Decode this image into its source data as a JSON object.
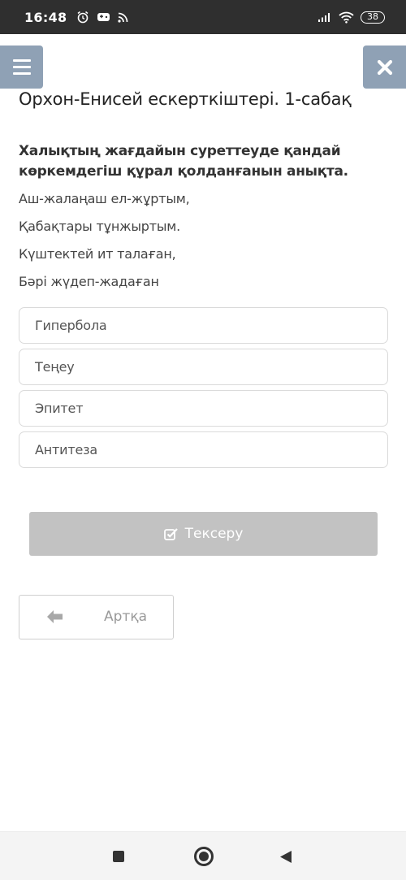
{
  "status_bar": {
    "time": "16:48",
    "battery": "38",
    "icons": [
      "alarm-icon",
      "gamepad-icon",
      "cast-icon",
      "signal-icon",
      "wifi-icon",
      "battery-icon"
    ]
  },
  "header": {
    "menu_icon": "hamburger-icon",
    "close_icon": "close-icon",
    "title": "Орхон-Енисей ескерткіштері. 1-сабақ"
  },
  "question": {
    "prompt": "Халықтың жағдайын суреттеуде қандай көркемдегіш құрал қолданғанын анықта.",
    "lines": [
      "Аш-жалаңаш ел-жұртым,",
      "Қабақтары тұнжыртым.",
      "Күштектей ит талаған,",
      "Бәрі жүдеп-жадаған"
    ]
  },
  "options": [
    {
      "label": "Гипербола"
    },
    {
      "label": "Теңеу"
    },
    {
      "label": "Эпитет"
    },
    {
      "label": "Антитеза"
    }
  ],
  "check_button": {
    "label": "Тексеру",
    "icon": "checkbox-icon"
  },
  "back_button": {
    "label": "Артқа",
    "icon": "arrow-left-icon"
  },
  "nav_bar": {
    "icons": [
      "recents-square-icon",
      "home-circle-icon",
      "back-triangle-icon"
    ]
  },
  "colors": {
    "status_bar": "#2f2f2f",
    "header_button": "#8fa1b5",
    "check_button_disabled": "#c2c2c2"
  }
}
